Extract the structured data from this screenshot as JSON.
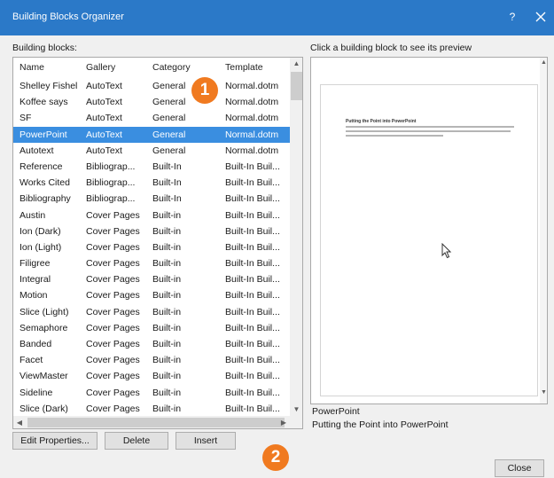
{
  "window": {
    "title": "Building Blocks Organizer",
    "help_label": "?",
    "close_icon": "close-icon"
  },
  "list": {
    "label": "Building blocks:",
    "columns": [
      "Name",
      "Gallery",
      "Category",
      "Template"
    ],
    "selected_index": 3,
    "rows": [
      {
        "name": "Shelley Fishel",
        "gallery": "AutoText",
        "category": "General",
        "template": "Normal.dotm"
      },
      {
        "name": "Koffee says",
        "gallery": "AutoText",
        "category": "General",
        "template": "Normal.dotm"
      },
      {
        "name": "SF",
        "gallery": "AutoText",
        "category": "General",
        "template": "Normal.dotm"
      },
      {
        "name": "PowerPoint",
        "gallery": "AutoText",
        "category": "General",
        "template": "Normal.dotm"
      },
      {
        "name": "Autotext",
        "gallery": "AutoText",
        "category": "General",
        "template": "Normal.dotm"
      },
      {
        "name": "Reference",
        "gallery": "Bibliograp...",
        "category": "Built-In",
        "template": "Built-In Buil..."
      },
      {
        "name": "Works Cited",
        "gallery": "Bibliograp...",
        "category": "Built-In",
        "template": "Built-In Buil..."
      },
      {
        "name": "Bibliography",
        "gallery": "Bibliograp...",
        "category": "Built-In",
        "template": "Built-In Buil..."
      },
      {
        "name": "Austin",
        "gallery": "Cover Pages",
        "category": "Built-in",
        "template": "Built-In Buil..."
      },
      {
        "name": "Ion (Dark)",
        "gallery": "Cover Pages",
        "category": "Built-in",
        "template": "Built-In Buil..."
      },
      {
        "name": "Ion (Light)",
        "gallery": "Cover Pages",
        "category": "Built-in",
        "template": "Built-In Buil..."
      },
      {
        "name": "Filigree",
        "gallery": "Cover Pages",
        "category": "Built-in",
        "template": "Built-In Buil..."
      },
      {
        "name": "Integral",
        "gallery": "Cover Pages",
        "category": "Built-in",
        "template": "Built-In Buil..."
      },
      {
        "name": "Motion",
        "gallery": "Cover Pages",
        "category": "Built-in",
        "template": "Built-In Buil..."
      },
      {
        "name": "Slice (Light)",
        "gallery": "Cover Pages",
        "category": "Built-in",
        "template": "Built-In Buil..."
      },
      {
        "name": "Semaphore",
        "gallery": "Cover Pages",
        "category": "Built-in",
        "template": "Built-In Buil..."
      },
      {
        "name": "Banded",
        "gallery": "Cover Pages",
        "category": "Built-in",
        "template": "Built-In Buil..."
      },
      {
        "name": "Facet",
        "gallery": "Cover Pages",
        "category": "Built-in",
        "template": "Built-In Buil..."
      },
      {
        "name": "ViewMaster",
        "gallery": "Cover Pages",
        "category": "Built-in",
        "template": "Built-In Buil..."
      },
      {
        "name": "Sideline",
        "gallery": "Cover Pages",
        "category": "Built-in",
        "template": "Built-In Buil..."
      },
      {
        "name": "Slice (Dark)",
        "gallery": "Cover Pages",
        "category": "Built-in",
        "template": "Built-In Buil..."
      }
    ]
  },
  "preview": {
    "label": "Click a building block to see its preview",
    "page_title": "Putting the Point into PowerPoint",
    "block_name": "PowerPoint",
    "block_description": "Putting the Point into PowerPoint"
  },
  "buttons": {
    "edit": "Edit Properties...",
    "delete": "Delete",
    "insert": "Insert",
    "close": "Close"
  },
  "callouts": {
    "one": "1",
    "two": "2"
  },
  "colors": {
    "title_bar": "#2b79c8",
    "selection": "#3a8ee0",
    "callout": "#f07a20"
  }
}
